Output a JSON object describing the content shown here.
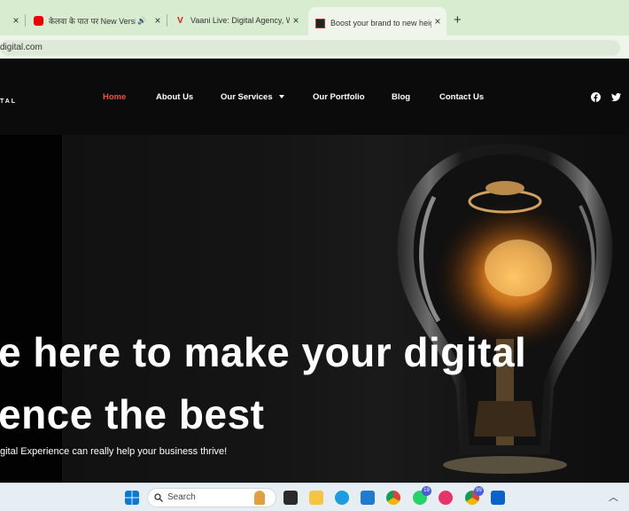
{
  "browser": {
    "tabs": [
      {
        "title": "",
        "close": "×"
      },
      {
        "title": "केलवा के पात पर New Versio",
        "close": "×",
        "audio": "🔊"
      },
      {
        "title": "Vaani Live: Digital Agency, Web",
        "close": "×"
      },
      {
        "title": "Boost your brand to new heigh",
        "close": "×",
        "active": true
      }
    ],
    "new_tab": "+",
    "url": "digital.com"
  },
  "site": {
    "logo_text": "TAL",
    "nav": [
      {
        "label": "Home",
        "active": true
      },
      {
        "label": "About Us"
      },
      {
        "label": "Our Services",
        "dropdown": true
      },
      {
        "label": "Our Portfolio"
      },
      {
        "label": "Blog"
      },
      {
        "label": "Contact Us"
      }
    ],
    "social_icons": [
      "facebook-icon",
      "twitter-icon"
    ]
  },
  "hero": {
    "headline_line1": "e here to make your digital",
    "headline_line2": "ence the best",
    "subtext": "gital Experience can really help your business thrive!"
  },
  "taskbar": {
    "search_placeholder": "Search",
    "whatsapp_badge": "19",
    "chrome_badge": "99"
  },
  "colors": {
    "accent": "#e8533a",
    "tab_strip": "#d8ecd0",
    "header_bg": "#0b0b0b"
  }
}
